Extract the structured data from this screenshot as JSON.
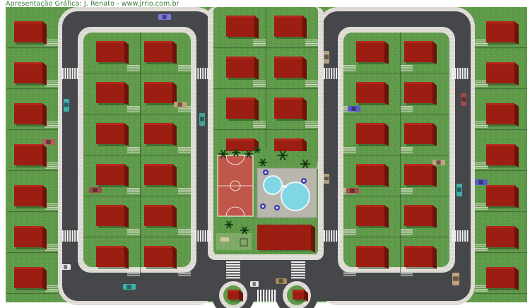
{
  "credit": "Apresentação Gráfica: J. Renato - www.jrrio.com.br",
  "colors": {
    "grass": "#5f9a4a",
    "asphalt": "#45474b",
    "sidewalk": "#d9d7cf",
    "roof": "#9c1e12",
    "roof_shade": "#6e130b",
    "court": "#c0574b",
    "pool": "#7fd6e4",
    "plaza": "#b8b6ad"
  },
  "cars": [
    {
      "color": "#7a7ae0"
    },
    {
      "color": "#3fb0a8"
    },
    {
      "color": "#b85a5a"
    },
    {
      "color": "#c9a072"
    },
    {
      "color": "#a24a4a"
    },
    {
      "color": "#47a39a"
    },
    {
      "color": "#b3a280"
    },
    {
      "color": "#5a5ad0"
    },
    {
      "color": "#b04a4a"
    },
    {
      "color": "#c3a37a"
    },
    {
      "color": "#5a5ad0"
    },
    {
      "color": "#3fb0a8"
    },
    {
      "color": "#e5e5e5"
    },
    {
      "color": "#3fb0a8"
    },
    {
      "color": "#a78a5a"
    },
    {
      "color": "#e5e5e5"
    },
    {
      "color": "#c3a37a"
    },
    {
      "color": "#a24a4a"
    },
    {
      "color": "#b3a280"
    }
  ]
}
